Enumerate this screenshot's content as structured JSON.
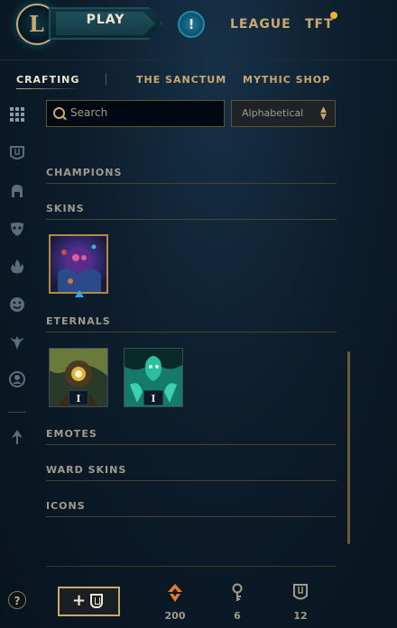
{
  "header": {
    "logo_letter": "L",
    "play_label": "PLAY",
    "alert_symbol": "!",
    "nav": [
      "LEAGUE",
      "TFT"
    ],
    "notification_color": "#f0b232"
  },
  "subnav": {
    "tabs": [
      "CRAFTING",
      "THE SANCTUM",
      "MYTHIC SHOP"
    ],
    "active": "CRAFTING"
  },
  "sidebar": {
    "icons": [
      "grid-icon",
      "chest-icon",
      "helmet-icon",
      "mask-icon",
      "flame-icon",
      "smiley-icon",
      "ward-icon",
      "profile-icon",
      "arrow-icon"
    ]
  },
  "search": {
    "placeholder": "Search"
  },
  "sort": {
    "selected": "Alphabetical"
  },
  "sections": {
    "champions": "CHAMPIONS",
    "skins": "SKINS",
    "eternals": "ETERNALS",
    "emotes": "EMOTES",
    "ward_skins": "WARD SKINS",
    "icons": "ICONS"
  },
  "eternals": [
    {
      "count": "I"
    },
    {
      "count": "I"
    }
  ],
  "footer": {
    "help_symbol": "?",
    "add_label": "+",
    "currencies": [
      {
        "icon": "orange-essence-icon",
        "value": "200",
        "color": "#e67c2a"
      },
      {
        "icon": "key-icon",
        "value": "6",
        "color": "#a09b8c"
      },
      {
        "icon": "chest-icon",
        "value": "12",
        "color": "#a09b8c"
      }
    ]
  }
}
